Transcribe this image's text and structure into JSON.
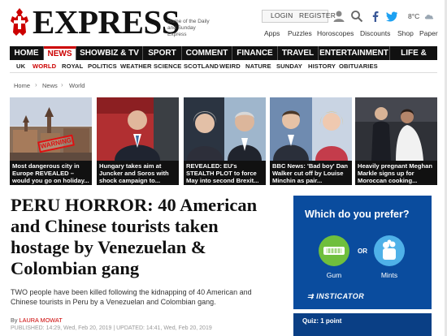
{
  "header": {
    "logo": "EXPRESS",
    "tagline": "Home of the Daily and Sunday Express",
    "login_label": "LOGIN",
    "register_label": "REGISTER",
    "weather": "8°C",
    "sub_links": [
      "Apps",
      "Puzzles",
      "Horoscopes",
      "Discounts",
      "Shop",
      "Paper"
    ]
  },
  "nav": {
    "items": [
      "HOME",
      "NEWS",
      "SHOWBIZ & TV",
      "SPORT",
      "COMMENT",
      "FINANCE",
      "TRAVEL",
      "ENTERTAINMENT",
      "LIFE & STYLE"
    ],
    "active": "NEWS"
  },
  "subnav": {
    "items": [
      "UK",
      "WORLD",
      "ROYAL",
      "POLITICS",
      "WEATHER",
      "SCIENCE",
      "SCOTLAND",
      "WEIRD",
      "NATURE",
      "SUNDAY",
      "HISTORY",
      "OBITUARIES"
    ],
    "active": "WORLD"
  },
  "breadcrumb": [
    "Home",
    "News",
    "World"
  ],
  "stories": [
    {
      "caption": "Most dangerous city in Europe REVEALED – would you go on holiday...",
      "badge": "WARNING"
    },
    {
      "caption": "Hungary takes aim at Juncker and Soros with shock campaign to..."
    },
    {
      "caption": "REVEALED: EU's STEALTH PLOT to force May into second Brexit..."
    },
    {
      "caption": "BBC News: 'Bad boy' Dan Walker cut off by Louise Minchin as pair..."
    },
    {
      "caption": "Heavily pregnant Meghan Markle signs up for Moroccan cooking..."
    }
  ],
  "article": {
    "headline": "PERU HORROR: 40 American and Chinese tourists taken hostage by Venezuelan & Colombian gang",
    "standfirst": "TWO people have been killed following the kidnapping of 40 American and Chinese tourists in Peru by a Venezuelan and Colombian gang.",
    "byline_prefix": "By",
    "author": "LAURA MOWAT",
    "published": "PUBLISHED: 14:29, Wed, Feb 20, 2019 | UPDATED: 14:41, Wed, Feb 20, 2019"
  },
  "ad": {
    "question": "Which do you prefer?",
    "option_a": "Gum",
    "option_b": "Mints",
    "or_label": "OR",
    "brand": "INSTICATOR",
    "quiz_label": "Quiz: 1 point"
  },
  "colors": {
    "brand_red": "#c00000",
    "nav_bg": "#111111",
    "ad_blue": "#0a4c9e",
    "gum_green": "#6fbf3d",
    "mints_blue": "#4fb1e8"
  },
  "icons": [
    "crusader-logo-icon",
    "user-icon",
    "facebook-icon",
    "twitter-icon",
    "weather-cloud-icon",
    "gum-icon",
    "mints-icon"
  ]
}
